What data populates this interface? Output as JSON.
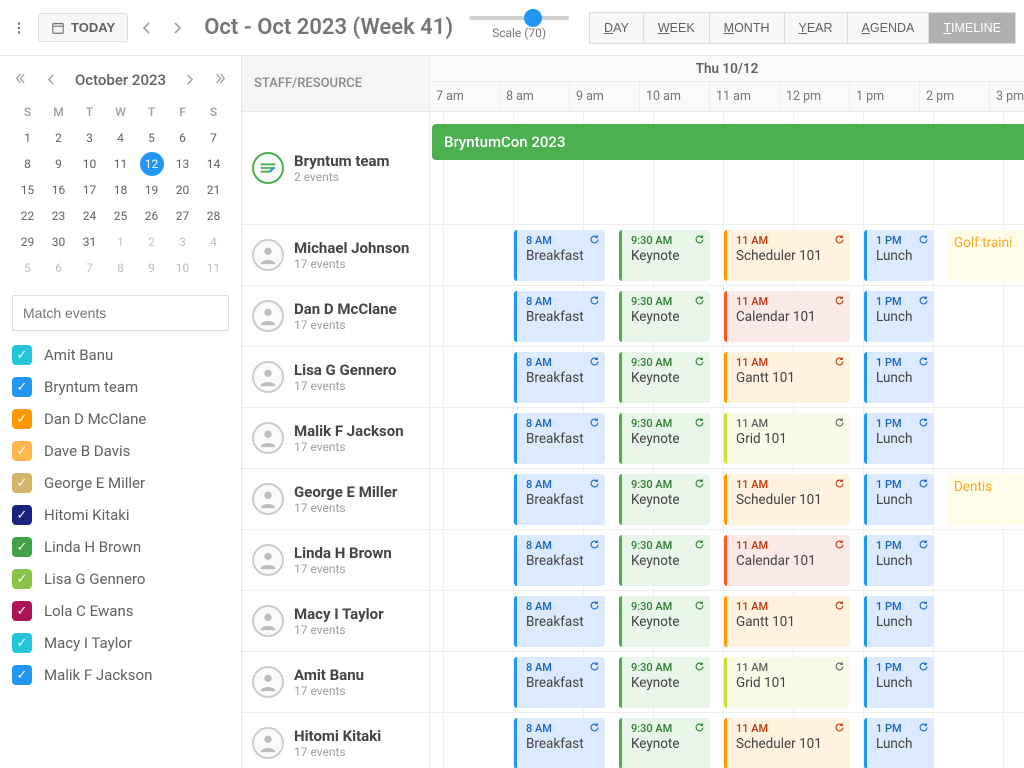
{
  "topbar": {
    "today_label": "TODAY",
    "title": "Oct - Oct 2023 (Week 41)",
    "scale_label": "Scale (70)",
    "scale_value": 70,
    "view_tabs": [
      {
        "key": "D",
        "rest": "AY"
      },
      {
        "key": "W",
        "rest": "EEK"
      },
      {
        "key": "M",
        "rest": "ONTH"
      },
      {
        "key": "Y",
        "rest": "EAR"
      },
      {
        "key": "A",
        "rest": "GENDA"
      },
      {
        "key": "T",
        "rest": "IMELINE"
      }
    ],
    "active_tab": 5
  },
  "sidebar": {
    "cal_title": "October 2023",
    "day_headers": [
      "S",
      "M",
      "T",
      "W",
      "T",
      "F",
      "S"
    ],
    "weeks": [
      [
        {
          "d": 1
        },
        {
          "d": 2
        },
        {
          "d": 3
        },
        {
          "d": 4
        },
        {
          "d": 5
        },
        {
          "d": 6
        },
        {
          "d": 7
        }
      ],
      [
        {
          "d": 8
        },
        {
          "d": 9
        },
        {
          "d": 10
        },
        {
          "d": 11
        },
        {
          "d": 12,
          "today": true
        },
        {
          "d": 13
        },
        {
          "d": 14
        }
      ],
      [
        {
          "d": 15
        },
        {
          "d": 16
        },
        {
          "d": 17
        },
        {
          "d": 18
        },
        {
          "d": 19
        },
        {
          "d": 20
        },
        {
          "d": 21
        }
      ],
      [
        {
          "d": 22
        },
        {
          "d": 23
        },
        {
          "d": 24
        },
        {
          "d": 25
        },
        {
          "d": 26
        },
        {
          "d": 27
        },
        {
          "d": 28
        }
      ],
      [
        {
          "d": 29
        },
        {
          "d": 30
        },
        {
          "d": 31
        },
        {
          "d": 1,
          "other": true
        },
        {
          "d": 2,
          "other": true
        },
        {
          "d": 3,
          "other": true
        },
        {
          "d": 4,
          "other": true
        }
      ],
      [
        {
          "d": 5,
          "other": true
        },
        {
          "d": 6,
          "other": true
        },
        {
          "d": 7,
          "other": true
        },
        {
          "d": 8,
          "other": true
        },
        {
          "d": 9,
          "other": true
        },
        {
          "d": 10,
          "other": true
        },
        {
          "d": 11,
          "other": true
        }
      ]
    ],
    "match_placeholder": "Match events",
    "filters": [
      {
        "label": "Amit Banu",
        "color": "#26c6da"
      },
      {
        "label": "Bryntum team",
        "color": "#2196f3"
      },
      {
        "label": "Dan D McClane",
        "color": "#ff9800"
      },
      {
        "label": "Dave B Davis",
        "color": "#ffb74d"
      },
      {
        "label": "George E Miller",
        "color": "#d4b267"
      },
      {
        "label": "Hitomi Kitaki",
        "color": "#1a237e"
      },
      {
        "label": "Linda H Brown",
        "color": "#43a047"
      },
      {
        "label": "Lisa G Gennero",
        "color": "#8bc34a"
      },
      {
        "label": "Lola C Ewans",
        "color": "#ad1457"
      },
      {
        "label": "Macy I Taylor",
        "color": "#26c6da"
      },
      {
        "label": "Malik F Jackson",
        "color": "#2196f3"
      }
    ]
  },
  "resource_header": "STAFF/RESOURCE",
  "resources": [
    {
      "name": "Bryntum team",
      "sub": "2 events",
      "big": true,
      "logo": true
    },
    {
      "name": "Michael Johnson",
      "sub": "17 events"
    },
    {
      "name": "Dan D McClane",
      "sub": "17 events"
    },
    {
      "name": "Lisa G Gennero",
      "sub": "17 events"
    },
    {
      "name": "Malik F Jackson",
      "sub": "17 events"
    },
    {
      "name": "George E Miller",
      "sub": "17 events"
    },
    {
      "name": "Linda H Brown",
      "sub": "17 events"
    },
    {
      "name": "Macy I Taylor",
      "sub": "17 events"
    },
    {
      "name": "Amit Banu",
      "sub": "17 events"
    },
    {
      "name": "Hitomi Kitaki",
      "sub": "17 events"
    }
  ],
  "timeline": {
    "day_label": "Thu 10/12",
    "hours": [
      "7 am",
      "8 am",
      "9 am",
      "10 am",
      "11 am",
      "12 pm",
      "1 pm",
      "2 pm",
      "3 pm"
    ],
    "hour_width": 70,
    "span_event": "BryntumCon 2023",
    "rows": [
      [],
      [
        {
          "t": "8 AM",
          "l": "Breakfast",
          "start": 8,
          "end": 9.3,
          "c": "blue",
          "r": true
        },
        {
          "t": "9:30 AM",
          "l": "Keynote",
          "start": 9.5,
          "end": 10.8,
          "c": "green",
          "r": true
        },
        {
          "t": "11 AM",
          "l": "Scheduler 101",
          "start": 11,
          "end": 12.8,
          "c": "orange",
          "r": true
        },
        {
          "t": "1 PM",
          "l": "Lunch",
          "start": 13,
          "end": 14,
          "c": "blue",
          "r": true
        },
        {
          "t": "",
          "l": "Golf traini",
          "start": 14.2,
          "end": 15.5,
          "c": "yellow",
          "r": false,
          "noborder": true
        }
      ],
      [
        {
          "t": "8 AM",
          "l": "Breakfast",
          "start": 8,
          "end": 9.3,
          "c": "blue",
          "r": true
        },
        {
          "t": "9:30 AM",
          "l": "Keynote",
          "start": 9.5,
          "end": 10.8,
          "c": "green",
          "r": true
        },
        {
          "t": "11 AM",
          "l": "Calendar 101",
          "start": 11,
          "end": 12.8,
          "c": "deeporange",
          "r": true
        },
        {
          "t": "1 PM",
          "l": "Lunch",
          "start": 13,
          "end": 14,
          "c": "blue",
          "r": true
        }
      ],
      [
        {
          "t": "8 AM",
          "l": "Breakfast",
          "start": 8,
          "end": 9.3,
          "c": "blue",
          "r": true
        },
        {
          "t": "9:30 AM",
          "l": "Keynote",
          "start": 9.5,
          "end": 10.8,
          "c": "green",
          "r": true
        },
        {
          "t": "11 AM",
          "l": "Gantt 101",
          "start": 11,
          "end": 12.8,
          "c": "orange",
          "r": true
        },
        {
          "t": "1 PM",
          "l": "Lunch",
          "start": 13,
          "end": 14,
          "c": "blue",
          "r": true
        }
      ],
      [
        {
          "t": "8 AM",
          "l": "Breakfast",
          "start": 8,
          "end": 9.3,
          "c": "blue",
          "r": true
        },
        {
          "t": "9:30 AM",
          "l": "Keynote",
          "start": 9.5,
          "end": 10.8,
          "c": "green",
          "r": true
        },
        {
          "t": "11 AM",
          "l": "Grid 101",
          "start": 11,
          "end": 12.8,
          "c": "lime",
          "r": true
        },
        {
          "t": "1 PM",
          "l": "Lunch",
          "start": 13,
          "end": 14,
          "c": "blue",
          "r": true
        }
      ],
      [
        {
          "t": "8 AM",
          "l": "Breakfast",
          "start": 8,
          "end": 9.3,
          "c": "blue",
          "r": true
        },
        {
          "t": "9:30 AM",
          "l": "Keynote",
          "start": 9.5,
          "end": 10.8,
          "c": "green",
          "r": true
        },
        {
          "t": "11 AM",
          "l": "Scheduler 101",
          "start": 11,
          "end": 12.8,
          "c": "orange",
          "r": true
        },
        {
          "t": "1 PM",
          "l": "Lunch",
          "start": 13,
          "end": 14,
          "c": "blue",
          "r": true
        },
        {
          "t": "",
          "l": "Dentis",
          "start": 14.2,
          "end": 15.5,
          "c": "yellow",
          "r": false,
          "noborder": true
        }
      ],
      [
        {
          "t": "8 AM",
          "l": "Breakfast",
          "start": 8,
          "end": 9.3,
          "c": "blue",
          "r": true
        },
        {
          "t": "9:30 AM",
          "l": "Keynote",
          "start": 9.5,
          "end": 10.8,
          "c": "green",
          "r": true
        },
        {
          "t": "11 AM",
          "l": "Calendar 101",
          "start": 11,
          "end": 12.8,
          "c": "deeporange",
          "r": true
        },
        {
          "t": "1 PM",
          "l": "Lunch",
          "start": 13,
          "end": 14,
          "c": "blue",
          "r": true
        }
      ],
      [
        {
          "t": "8 AM",
          "l": "Breakfast",
          "start": 8,
          "end": 9.3,
          "c": "blue",
          "r": true
        },
        {
          "t": "9:30 AM",
          "l": "Keynote",
          "start": 9.5,
          "end": 10.8,
          "c": "green",
          "r": true
        },
        {
          "t": "11 AM",
          "l": "Gantt 101",
          "start": 11,
          "end": 12.8,
          "c": "orange",
          "r": true
        },
        {
          "t": "1 PM",
          "l": "Lunch",
          "start": 13,
          "end": 14,
          "c": "blue",
          "r": true
        }
      ],
      [
        {
          "t": "8 AM",
          "l": "Breakfast",
          "start": 8,
          "end": 9.3,
          "c": "blue",
          "r": true
        },
        {
          "t": "9:30 AM",
          "l": "Keynote",
          "start": 9.5,
          "end": 10.8,
          "c": "green",
          "r": true
        },
        {
          "t": "11 AM",
          "l": "Grid 101",
          "start": 11,
          "end": 12.8,
          "c": "lime",
          "r": true
        },
        {
          "t": "1 PM",
          "l": "Lunch",
          "start": 13,
          "end": 14,
          "c": "blue",
          "r": true
        }
      ],
      [
        {
          "t": "8 AM",
          "l": "Breakfast",
          "start": 8,
          "end": 9.3,
          "c": "blue",
          "r": true
        },
        {
          "t": "9:30 AM",
          "l": "Keynote",
          "start": 9.5,
          "end": 10.8,
          "c": "green",
          "r": true
        },
        {
          "t": "11 AM",
          "l": "Scheduler 101",
          "start": 11,
          "end": 12.8,
          "c": "orange",
          "r": true
        },
        {
          "t": "1 PM",
          "l": "Lunch",
          "start": 13,
          "end": 14,
          "c": "blue",
          "r": true
        }
      ]
    ]
  }
}
